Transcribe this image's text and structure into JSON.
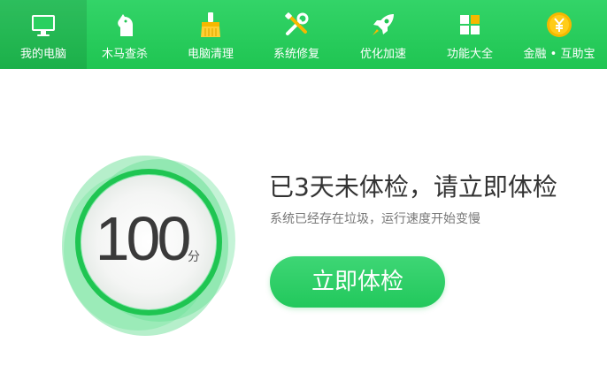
{
  "nav": {
    "items": [
      {
        "label": "我的电脑",
        "icon": "monitor-icon",
        "active": true
      },
      {
        "label": "木马查杀",
        "icon": "horse-icon",
        "active": false
      },
      {
        "label": "电脑清理",
        "icon": "broom-icon",
        "active": false
      },
      {
        "label": "系统修复",
        "icon": "tools-icon",
        "active": false
      },
      {
        "label": "优化加速",
        "icon": "rocket-icon",
        "active": false
      },
      {
        "label": "功能大全",
        "icon": "grid-icon",
        "active": false
      },
      {
        "label": "金融 • 互助宝",
        "icon": "yuan-coin-icon",
        "active": false
      }
    ]
  },
  "score": {
    "value": "100",
    "unit": "分"
  },
  "main": {
    "headline": "已3天未体检，请立即体检",
    "subline": "系统已经存在垃圾，运行速度开始变慢",
    "check_button_label": "立即体检"
  },
  "colors": {
    "brand_green": "#1fc552",
    "button_green": "#22c85c",
    "coin_yellow": "#f5b800"
  }
}
